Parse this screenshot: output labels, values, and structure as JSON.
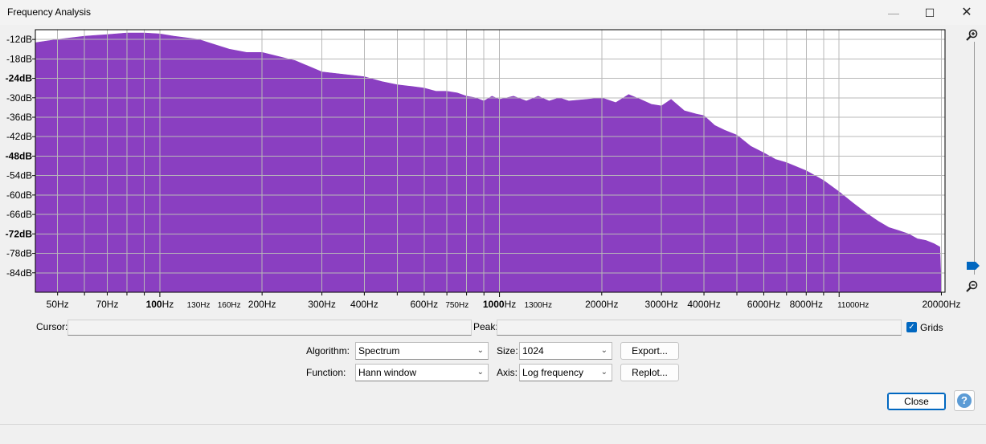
{
  "window": {
    "title": "Frequency Analysis",
    "minimize_glyph": "—",
    "maximize_glyph": "☐",
    "close_glyph": "✕"
  },
  "chart_data": {
    "type": "area",
    "fill_color": "#8a3fc1",
    "grid": true,
    "x_scale": "log",
    "xlim": [
      43,
      20500
    ],
    "ylim": [
      -90,
      -9
    ],
    "y_ticks": [
      {
        "value": -12,
        "label": "-12dB",
        "bold": false
      },
      {
        "value": -18,
        "label": "-18dB",
        "bold": false
      },
      {
        "value": -24,
        "label": "-24dB",
        "bold": true
      },
      {
        "value": -30,
        "label": "-30dB",
        "bold": false
      },
      {
        "value": -36,
        "label": "-36dB",
        "bold": false
      },
      {
        "value": -42,
        "label": "-42dB",
        "bold": false
      },
      {
        "value": -48,
        "label": "-48dB",
        "bold": true
      },
      {
        "value": -54,
        "label": "-54dB",
        "bold": false
      },
      {
        "value": -60,
        "label": "-60dB",
        "bold": false
      },
      {
        "value": -66,
        "label": "-66dB",
        "bold": false
      },
      {
        "value": -72,
        "label": "-72dB",
        "bold": true
      },
      {
        "value": -78,
        "label": "-78dB",
        "bold": false
      },
      {
        "value": -84,
        "label": "-84dB",
        "bold": false
      }
    ],
    "x_ticks": [
      {
        "value": 50,
        "label": "50Hz",
        "style": "normal"
      },
      {
        "value": 70,
        "label": "70Hz",
        "style": "normal"
      },
      {
        "value": 100,
        "label": "100",
        "unit": "Hz",
        "style": "bold"
      },
      {
        "value": 130,
        "label": "130Hz",
        "style": "small"
      },
      {
        "value": 160,
        "label": "160Hz",
        "style": "small"
      },
      {
        "value": 200,
        "label": "200Hz",
        "style": "normal"
      },
      {
        "value": 300,
        "label": "300Hz",
        "style": "normal"
      },
      {
        "value": 400,
        "label": "400Hz",
        "style": "normal"
      },
      {
        "value": 600,
        "label": "600Hz",
        "style": "normal"
      },
      {
        "value": 750,
        "label": "750Hz",
        "style": "small"
      },
      {
        "value": 1000,
        "label": "1000",
        "unit": "Hz",
        "style": "bold"
      },
      {
        "value": 1300,
        "label": "1300Hz",
        "style": "small"
      },
      {
        "value": 2000,
        "label": "2000Hz",
        "style": "normal"
      },
      {
        "value": 3000,
        "label": "3000Hz",
        "style": "normal"
      },
      {
        "value": 4000,
        "label": "4000Hz",
        "style": "normal"
      },
      {
        "value": 6000,
        "label": "6000Hz",
        "style": "normal"
      },
      {
        "value": 8000,
        "label": "8000Hz",
        "style": "normal"
      },
      {
        "value": 11000,
        "label": "11000Hz",
        "style": "small"
      },
      {
        "value": 20000,
        "label": "20000Hz",
        "style": "normal"
      }
    ],
    "grid_major_x": [
      50,
      60,
      70,
      80,
      90,
      100,
      200,
      300,
      400,
      500,
      600,
      700,
      800,
      900,
      1000,
      2000,
      3000,
      4000,
      5000,
      6000,
      7000,
      8000,
      9000,
      10000,
      20000
    ],
    "series": [
      {
        "x": [
          43,
          50,
          60,
          70,
          80,
          90,
          100,
          110,
          130,
          160,
          180,
          200,
          250,
          300,
          400,
          450,
          500,
          550,
          600,
          650,
          700,
          750,
          800,
          850,
          900,
          950,
          1000,
          1100,
          1200,
          1300,
          1400,
          1500,
          1600,
          1800,
          2000,
          2200,
          2400,
          2600,
          2800,
          3000,
          3200,
          3500,
          3800,
          4000,
          4300,
          4600,
          5000,
          5500,
          6000,
          6500,
          7000,
          8000,
          9000,
          10000,
          11000,
          12000,
          13000,
          14000,
          15000,
          16000,
          17000,
          18000,
          19000,
          19800,
          20000
        ],
        "y": [
          -13,
          -12,
          -11,
          -10.5,
          -10,
          -10,
          -10.3,
          -11,
          -12,
          -15,
          -16,
          -16,
          -18.5,
          -22,
          -23.5,
          -25,
          -26,
          -26.5,
          -27,
          -28,
          -28,
          -28.5,
          -29.5,
          -30,
          -31,
          -29.5,
          -30.5,
          -29.5,
          -31,
          -29.5,
          -31,
          -30,
          -31,
          -30.5,
          -30,
          -31.5,
          -29,
          -30.5,
          -32,
          -32.5,
          -30.5,
          -34,
          -35,
          -35.5,
          -38.5,
          -40,
          -41.5,
          -45,
          -47,
          -49,
          -50,
          -52.5,
          -55.5,
          -59,
          -62.5,
          -65.5,
          -68,
          -70,
          -71,
          -72,
          -73.5,
          -74,
          -75,
          -76,
          -90
        ]
      }
    ]
  },
  "cursor": {
    "label": "Cursor:",
    "value": ""
  },
  "peak": {
    "label": "Peak:",
    "value": ""
  },
  "grids": {
    "label": "Grids",
    "checked": true,
    "check_glyph": "✓"
  },
  "algorithm": {
    "label": "Algorithm:",
    "value": "Spectrum"
  },
  "function": {
    "label": "Function:",
    "value": "Hann window"
  },
  "size": {
    "label": "Size:",
    "value": "1024"
  },
  "axis": {
    "label": "Axis:",
    "value": "Log frequency"
  },
  "buttons": {
    "export": "Export...",
    "replot": "Replot...",
    "close": "Close",
    "help": "?"
  },
  "select_chevron": "⌄"
}
